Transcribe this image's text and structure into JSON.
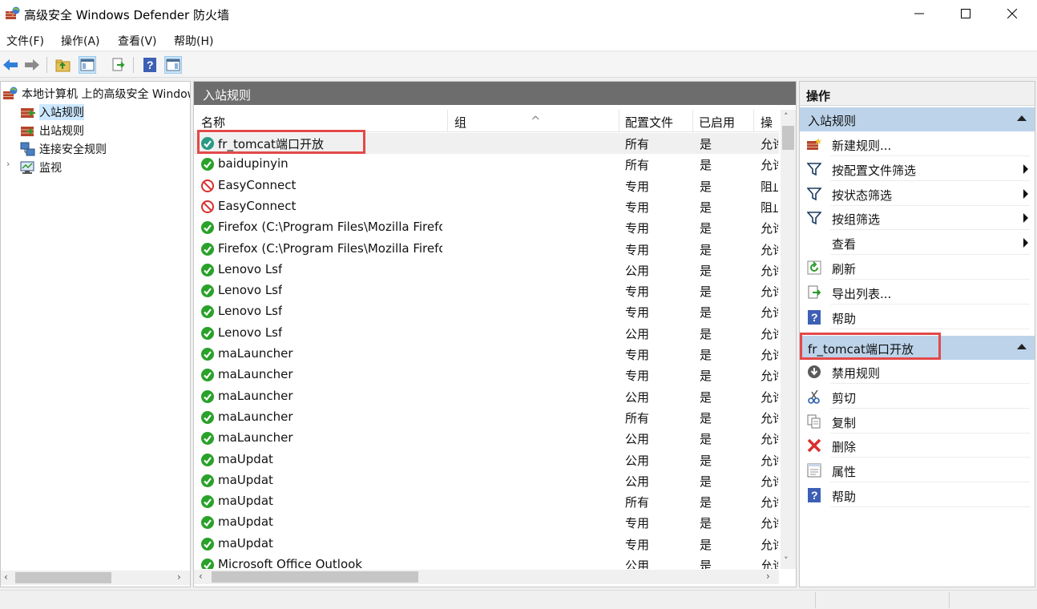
{
  "window": {
    "title": "高级安全 Windows Defender 防火墙",
    "controls": [
      "minimize",
      "maximize",
      "close"
    ]
  },
  "menu": {
    "items": [
      "文件(F)",
      "操作(A)",
      "查看(V)",
      "帮助(H)"
    ]
  },
  "toolbar": {
    "buttons": [
      "back-icon",
      "forward-icon",
      "up-folder-icon",
      "show-hide-tree-icon",
      "export-list-icon",
      "help-icon",
      "show-hide-action-pane-icon"
    ]
  },
  "tree": {
    "root": "本地计算机 上的高级安全 Windows Defender 防火墙",
    "items": [
      {
        "label": "入站规则",
        "selected": true
      },
      {
        "label": "出站规则",
        "selected": false
      },
      {
        "label": "连接安全规则",
        "selected": false
      },
      {
        "label": "监视",
        "selected": false
      }
    ]
  },
  "center": {
    "header": "入站规则",
    "columns": [
      "名称",
      "组",
      "配置文件",
      "已启用",
      "操作"
    ],
    "rows": [
      {
        "name": "fr_tomcat端口开放",
        "profile": "所有",
        "enabled": "是",
        "action": "允许",
        "status": "allow-selected"
      },
      {
        "name": "baidupinyin",
        "profile": "所有",
        "enabled": "是",
        "action": "允许",
        "status": "allow"
      },
      {
        "name": "EasyConnect",
        "profile": "专用",
        "enabled": "是",
        "action": "阻止",
        "status": "block"
      },
      {
        "name": "EasyConnect",
        "profile": "专用",
        "enabled": "是",
        "action": "阻止",
        "status": "block"
      },
      {
        "name": "Firefox (C:\\Program Files\\Mozilla Firefox)",
        "profile": "专用",
        "enabled": "是",
        "action": "允许",
        "status": "allow"
      },
      {
        "name": "Firefox (C:\\Program Files\\Mozilla Firefox)",
        "profile": "专用",
        "enabled": "是",
        "action": "允许",
        "status": "allow"
      },
      {
        "name": "Lenovo Lsf",
        "profile": "公用",
        "enabled": "是",
        "action": "允许",
        "status": "allow"
      },
      {
        "name": "Lenovo Lsf",
        "profile": "专用",
        "enabled": "是",
        "action": "允许",
        "status": "allow"
      },
      {
        "name": "Lenovo Lsf",
        "profile": "专用",
        "enabled": "是",
        "action": "允许",
        "status": "allow"
      },
      {
        "name": "Lenovo Lsf",
        "profile": "公用",
        "enabled": "是",
        "action": "允许",
        "status": "allow"
      },
      {
        "name": "maLauncher",
        "profile": "专用",
        "enabled": "是",
        "action": "允许",
        "status": "allow"
      },
      {
        "name": "maLauncher",
        "profile": "专用",
        "enabled": "是",
        "action": "允许",
        "status": "allow"
      },
      {
        "name": "maLauncher",
        "profile": "公用",
        "enabled": "是",
        "action": "允许",
        "status": "allow"
      },
      {
        "name": "maLauncher",
        "profile": "所有",
        "enabled": "是",
        "action": "允许",
        "status": "allow"
      },
      {
        "name": "maLauncher",
        "profile": "公用",
        "enabled": "是",
        "action": "允许",
        "status": "allow"
      },
      {
        "name": "maUpdat",
        "profile": "公用",
        "enabled": "是",
        "action": "允许",
        "status": "allow"
      },
      {
        "name": "maUpdat",
        "profile": "公用",
        "enabled": "是",
        "action": "允许",
        "status": "allow"
      },
      {
        "name": "maUpdat",
        "profile": "所有",
        "enabled": "是",
        "action": "允许",
        "status": "allow"
      },
      {
        "name": "maUpdat",
        "profile": "专用",
        "enabled": "是",
        "action": "允许",
        "status": "allow"
      },
      {
        "name": "maUpdat",
        "profile": "专用",
        "enabled": "是",
        "action": "允许",
        "status": "allow"
      },
      {
        "name": "Microsoft Office Outlook",
        "profile": "公用",
        "enabled": "是",
        "action": "允许",
        "status": "allow"
      }
    ]
  },
  "actions": {
    "header": "操作",
    "section1": {
      "title": "入站规则",
      "items": [
        {
          "label": "新建规则...",
          "icon": "new-rule-icon",
          "submenu": false
        },
        {
          "label": "按配置文件筛选",
          "icon": "filter-icon",
          "submenu": true
        },
        {
          "label": "按状态筛选",
          "icon": "filter-icon",
          "submenu": true
        },
        {
          "label": "按组筛选",
          "icon": "filter-icon",
          "submenu": true
        },
        {
          "label": "查看",
          "icon": "",
          "submenu": true
        },
        {
          "label": "刷新",
          "icon": "refresh-icon",
          "submenu": false
        },
        {
          "label": "导出列表...",
          "icon": "export-icon",
          "submenu": false
        },
        {
          "label": "帮助",
          "icon": "help-icon",
          "submenu": false
        }
      ]
    },
    "section2": {
      "title": "fr_tomcat端口开放",
      "items": [
        {
          "label": "禁用规则",
          "icon": "disable-icon"
        },
        {
          "label": "剪切",
          "icon": "cut-icon"
        },
        {
          "label": "复制",
          "icon": "copy-icon"
        },
        {
          "label": "删除",
          "icon": "delete-icon"
        },
        {
          "label": "属性",
          "icon": "properties-icon"
        },
        {
          "label": "帮助",
          "icon": "help-icon"
        }
      ]
    }
  },
  "colors": {
    "highlight_box": "#e34949",
    "pane_header": "#6d6d6d",
    "section_header": "#bcd3ea",
    "allow_green": "#2aa12a",
    "block_red": "#d9302c"
  }
}
